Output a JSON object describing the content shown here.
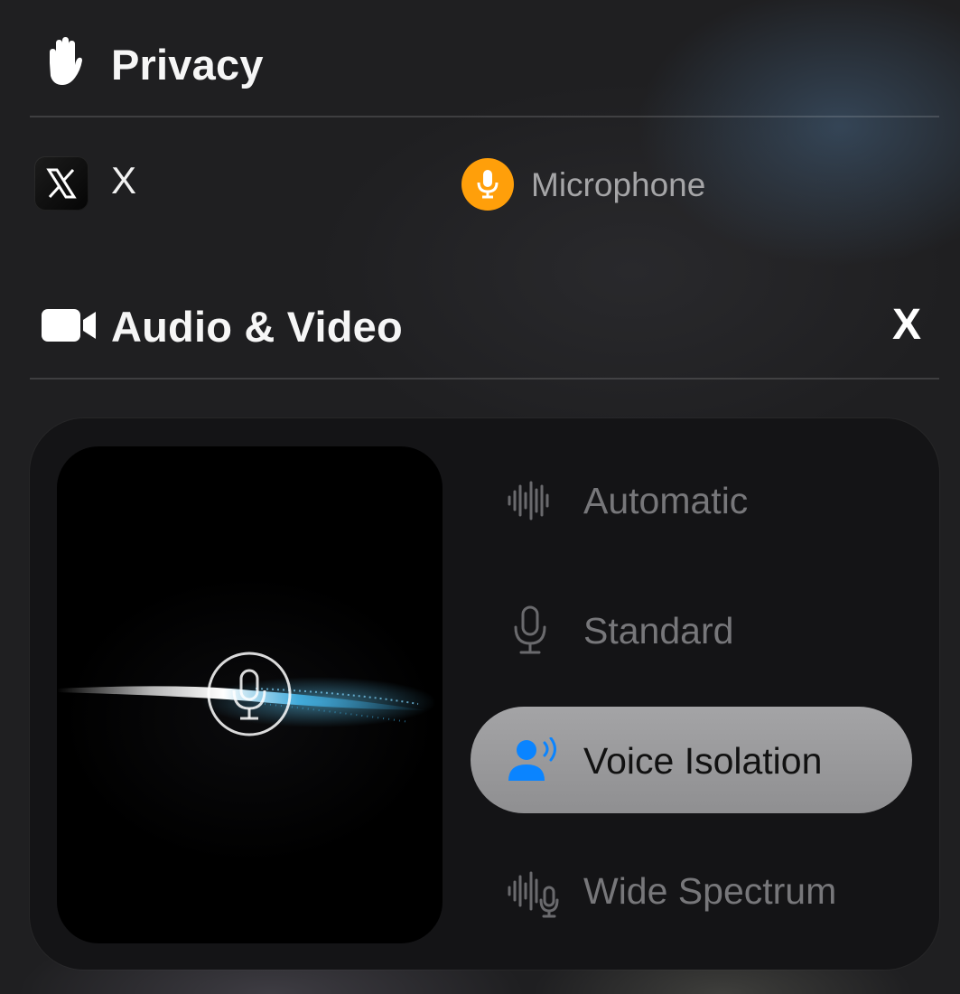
{
  "privacy": {
    "title": "Privacy",
    "icon": "hand-icon",
    "app_name": "X",
    "app_icon": "x-app-icon",
    "permission_label": "Microphone",
    "permission_icon": "microphone-icon",
    "permission_color": "#ff9f0a"
  },
  "audio_video": {
    "title": "Audio & Video",
    "icon": "video-camera-icon",
    "close_label": "X"
  },
  "mic_modes": {
    "selected": "Voice Isolation",
    "accent_color": "#0a84ff",
    "items": [
      {
        "label": "Automatic",
        "icon": "waveform-icon"
      },
      {
        "label": "Standard",
        "icon": "microphone-icon"
      },
      {
        "label": "Voice Isolation",
        "icon": "person-wave-icon"
      },
      {
        "label": "Wide Spectrum",
        "icon": "waveform-mic-icon"
      }
    ]
  }
}
